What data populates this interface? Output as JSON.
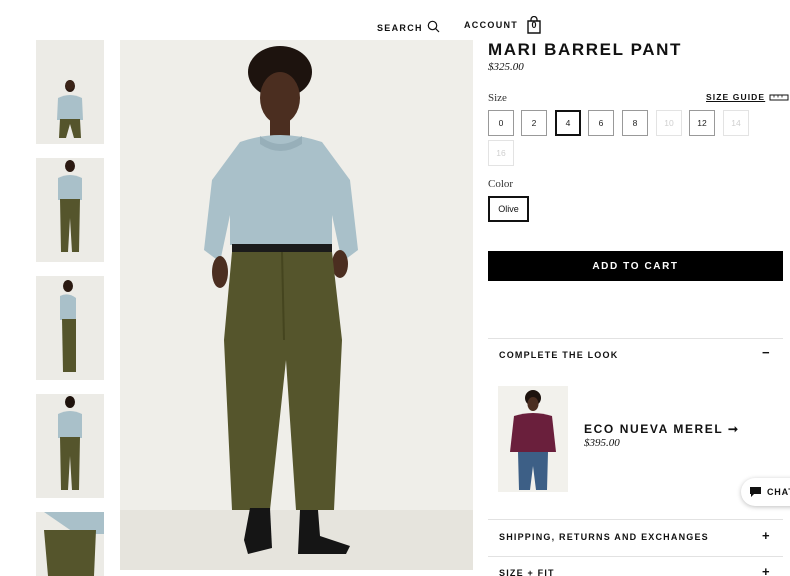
{
  "header": {
    "search_label": "SEARCH",
    "account_label": "ACCOUNT",
    "cart_count": "0"
  },
  "product": {
    "title": "MARI BARREL PANT",
    "price": "$325.00",
    "size_label": "Size",
    "size_guide": "SIZE GUIDE",
    "sizes": [
      {
        "label": "0",
        "state": "available"
      },
      {
        "label": "2",
        "state": "available"
      },
      {
        "label": "4",
        "state": "selected"
      },
      {
        "label": "6",
        "state": "available"
      },
      {
        "label": "8",
        "state": "available"
      },
      {
        "label": "10",
        "state": "unavailable"
      },
      {
        "label": "12",
        "state": "available"
      },
      {
        "label": "14",
        "state": "unavailable"
      },
      {
        "label": "16",
        "state": "unavailable"
      }
    ],
    "color_label": "Color",
    "color_value": "Olive",
    "add_to_cart": "ADD TO CART"
  },
  "complete_look": {
    "title": "COMPLETE THE LOOK",
    "toggle": "−",
    "item_name": "ECO NUEVA MEREL ➞",
    "item_price": "$395.00"
  },
  "accordions": [
    {
      "title": "SHIPPING, RETURNS AND EXCHANGES",
      "toggle": "+"
    },
    {
      "title": "SIZE + FIT",
      "toggle": "+"
    }
  ],
  "chat": {
    "label": "CHAT"
  },
  "colors": {
    "sweater": "#a9c0c9",
    "pant": "#55552c",
    "backdrop": "#efeee9",
    "merlot": "#6a1f3c",
    "denim": "#3d5f86"
  },
  "icons": [
    "search-icon",
    "cart-icon",
    "ruler-icon",
    "chat-icon"
  ]
}
